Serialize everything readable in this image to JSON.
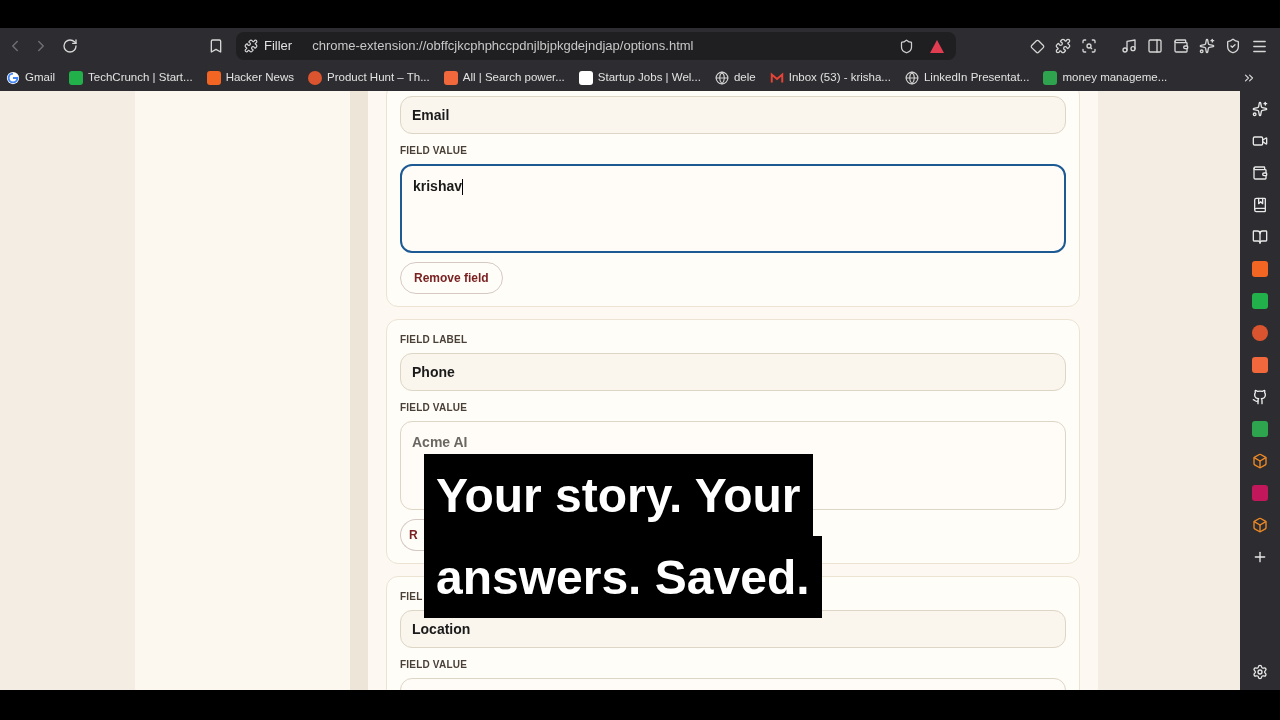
{
  "address_bar": {
    "site": "Filler",
    "url": "chrome-extension://obffcjkcphphccpdnjlbjpkgdejndjap/options.html"
  },
  "bookmarks": [
    "Gmail",
    "TechCrunch | Start...",
    "Hacker News",
    "Product Hunt – Th...",
    "All | Search power...",
    "Startup Jobs | Wel...",
    "dele",
    "Inbox (53) - krisha...",
    "LinkedIn Presentat...",
    "money manageme..."
  ],
  "cards": [
    {
      "label_value": "Email",
      "value_heading": "FIELD VALUE",
      "value": "krishav",
      "value_is_placeholder": false,
      "focused": true,
      "remove": "Remove field"
    },
    {
      "label_heading": "FIELD LABEL",
      "label_value": "Phone",
      "value_heading": "FIELD VALUE",
      "value": "Acme AI",
      "value_is_placeholder": true,
      "focused": false,
      "remove": "R"
    },
    {
      "label_heading": "FIEL",
      "label_value": "Location",
      "value_heading": "FIELD VALUE",
      "focused": false
    }
  ],
  "caption": {
    "lines": [
      "Your story. Your",
      "answers. Saved."
    ]
  }
}
